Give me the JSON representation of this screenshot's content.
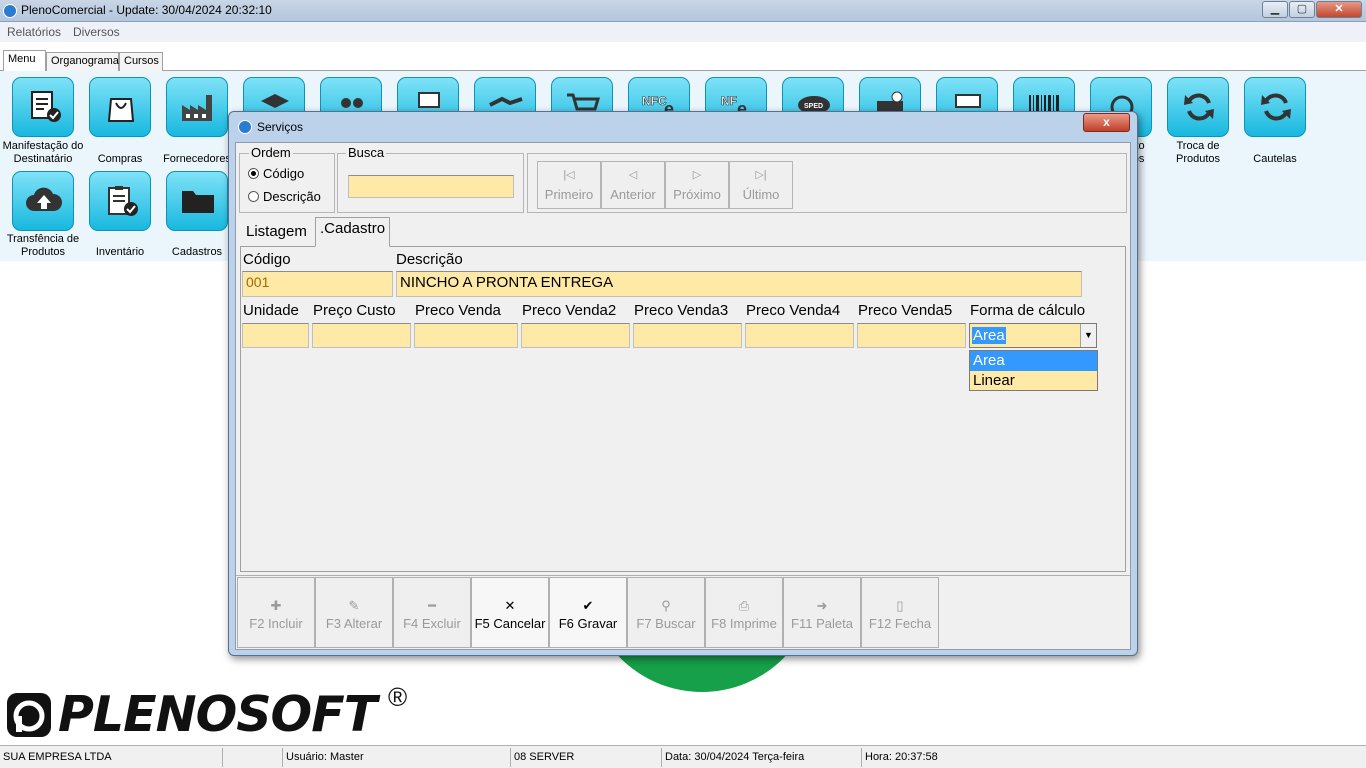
{
  "app": {
    "title": "PlenoComercial - Update: 30/04/2024 20:32:10"
  },
  "menubar": {
    "items": [
      "Relatórios",
      "Diversos"
    ]
  },
  "main_tabs": [
    "Menu",
    "Organograma",
    "Cursos"
  ],
  "tiles": [
    {
      "label": "Manifestação do Destinatário",
      "icon": "document-check-icon"
    },
    {
      "label": "Compras",
      "icon": "shopping-bag-icon"
    },
    {
      "label": "Fornecedores",
      "icon": "factory-icon"
    },
    {
      "label": "Troca de Produtos",
      "icon": "refresh-icon"
    },
    {
      "label": "Cautelas",
      "icon": "refresh-icon"
    },
    {
      "label": "Transfência de Produtos",
      "icon": "cloud-upload-icon"
    },
    {
      "label": "Inventário",
      "icon": "clipboard-check-icon"
    },
    {
      "label": "Cadastros",
      "icon": "folder-icon"
    }
  ],
  "partial_label_right": "nto",
  "partial_label_right2": "tos",
  "hidden_tiles": [
    "layers-icon",
    "users-icon",
    "report-icon",
    "handshake-icon",
    "cart-icon",
    "nfce-icon",
    "nfe-icon",
    "sped-icon",
    "cash-register-icon",
    "money-icon",
    "barcode-icon",
    "recycle-icon"
  ],
  "hidden_tile_texts": [
    "NFC",
    "e",
    "NF",
    "e",
    "SPED"
  ],
  "logo": {
    "text": "PLENOSOFT",
    "reg": "®"
  },
  "statusbar": {
    "empresa": "SUA EMPRESA LTDA",
    "usuario": "Usuário: Master",
    "server": "08 SERVER",
    "data": "Data: 30/04/2024 Terça-feira",
    "hora": "Hora: 20:37:58"
  },
  "dialog": {
    "title": "Serviços",
    "close": "x",
    "ordem": {
      "label": "Ordem",
      "options": [
        "Código",
        "Descrição"
      ],
      "selected": "Código"
    },
    "busca": {
      "label": "Busca",
      "value": ""
    },
    "nav": [
      "Primeiro",
      "Anterior",
      "Próximo",
      "Último"
    ],
    "tabs": [
      "Listagem",
      ".Cadastro"
    ],
    "active_tab": ".Cadastro",
    "form": {
      "codigo_label": "Código",
      "codigo_value": "001",
      "descricao_label": "Descrição",
      "descricao_value": "NINCHO A PRONTA ENTREGA",
      "columns": [
        "Unidade",
        "Preço Custo",
        "Preco Venda",
        "Preco Venda2",
        "Preco Venda3",
        "Preco Venda4",
        "Preco Venda5",
        "Forma de cálculo"
      ],
      "values": [
        "",
        "",
        "",
        "",
        "",
        "",
        ""
      ],
      "forma_calculo": {
        "selected": "Area",
        "options": [
          "Area",
          "Linear"
        ],
        "highlighted": "Area"
      }
    },
    "buttons": [
      {
        "label": "F2 Incluir",
        "enabled": false,
        "icon": "plus-icon"
      },
      {
        "label": "F3 Alterar",
        "enabled": false,
        "icon": "edit-icon"
      },
      {
        "label": "F4 Excluir",
        "enabled": false,
        "icon": "minus-icon"
      },
      {
        "label": "F5 Cancelar",
        "enabled": true,
        "icon": "x-icon"
      },
      {
        "label": "F6 Gravar",
        "enabled": true,
        "icon": "check-icon"
      },
      {
        "label": "F7 Buscar",
        "enabled": false,
        "icon": "binoculars-icon"
      },
      {
        "label": "F8 Imprime",
        "enabled": false,
        "icon": "printer-icon"
      },
      {
        "label": "F11 Paleta",
        "enabled": false,
        "icon": "palette-icon"
      },
      {
        "label": "F12 Fecha",
        "enabled": false,
        "icon": "door-icon"
      }
    ]
  }
}
